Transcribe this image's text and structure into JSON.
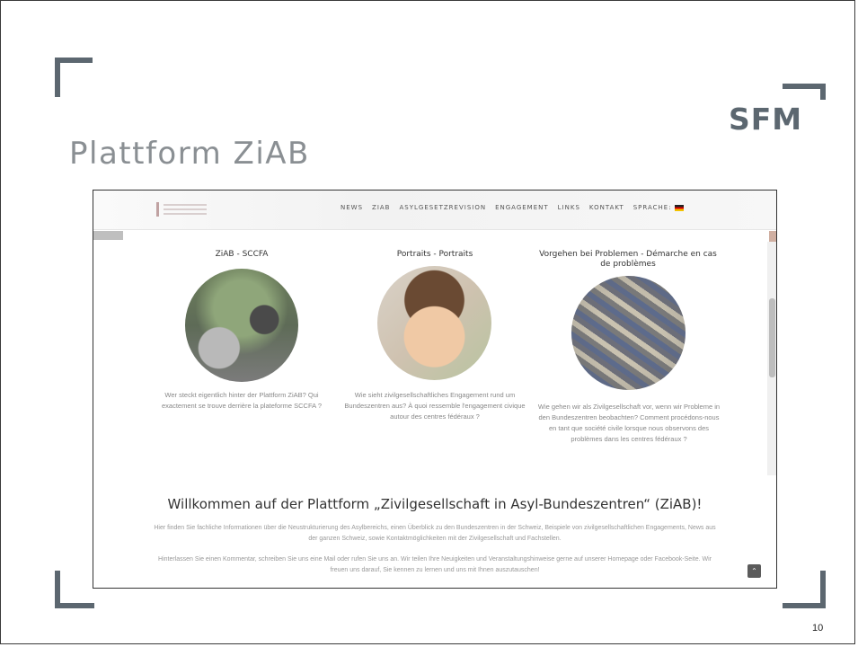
{
  "slide": {
    "title": "Plattform ZiAB",
    "logo": "SFM",
    "page_number": "10"
  },
  "website": {
    "nav": [
      "NEWS",
      "ZIAB",
      "ASYLGESETZREVISION",
      "ENGAGEMENT",
      "LINKS",
      "KONTAKT",
      "SPRACHE:"
    ],
    "columns": [
      {
        "title": "ZiAB - SCCFA",
        "text": "Wer steckt eigentlich hinter der Plattform ZiAB? Qui exactement se trouve derrière la plateforme SCCFA ?"
      },
      {
        "title": "Portraits - Portraits",
        "text": "Wie sieht zivilgesellschaftliches Engagement rund um Bundeszentren aus? À quoi ressemble l'engagement civique autour des centres fédéraux ?"
      },
      {
        "title": "Vorgehen bei Problemen - Démarche en cas de problèmes",
        "text": "Wie gehen wir als Zivilgesellschaft vor, wenn wir Probleme in den Bundeszentren beobachten? Comment procédons-nous en tant que société civile lorsque nous observons des problèmes dans les centres fédéraux ?"
      }
    ],
    "welcome_title": "Willkommen auf der Plattform „Zivilgesellschaft in Asyl-Bundeszentren“ (ZiAB)!",
    "paragraph1": "Hier finden Sie fachliche Informationen über die Neustrukturierung des Asylbereichs, einen Überblick zu den Bundeszentren in der Schweiz, Beispiele von zivilgesellschaftlichen Engagements, News aus der ganzen Schweiz, sowie Kontaktmöglichkeiten mit der Zivilgesellschaft und Fachstellen.",
    "paragraph2": "Hinterlassen Sie einen Kommentar, schreiben Sie uns eine Mail oder rufen Sie uns an. Wir teilen Ihre Neuigkeiten und Veranstaltungshinweise gerne auf unserer Homepage oder Facebook-Seite. Wir freuen uns darauf, Sie kennen zu lernen und uns mit Ihnen auszutauschen!"
  },
  "colors": {
    "corner": "#5c6770",
    "title": "#8a8f93"
  }
}
